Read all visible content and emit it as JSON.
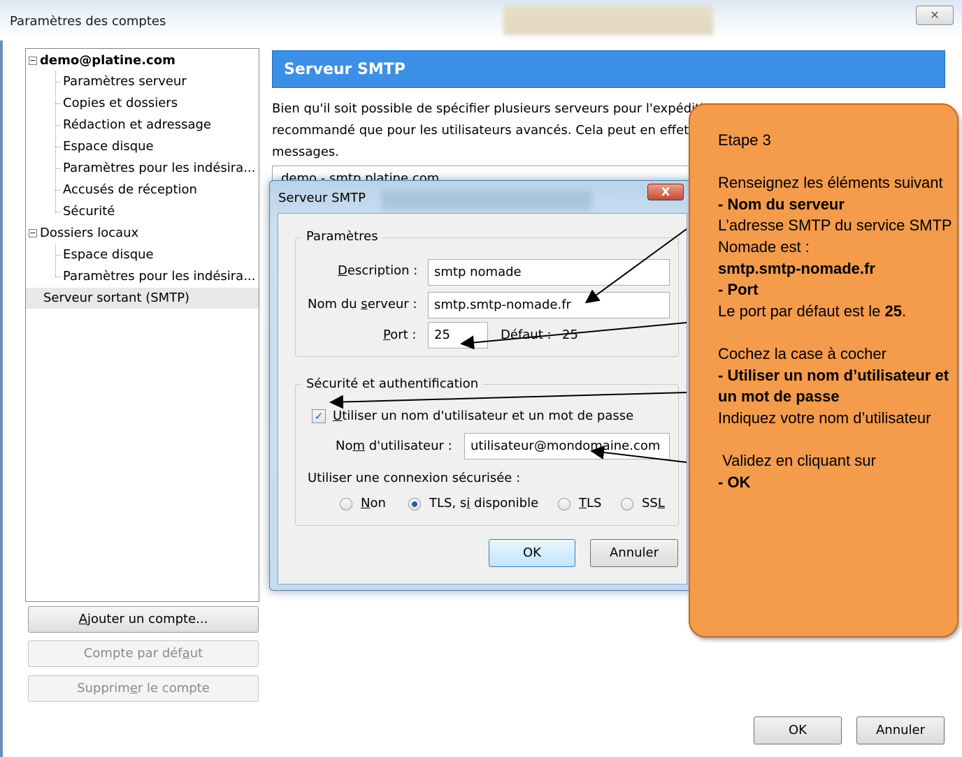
{
  "window": {
    "title": "Paramètres des comptes",
    "close_label": "✕"
  },
  "tree": {
    "account": "demo@platine.com",
    "account_items": [
      "Paramètres serveur",
      "Copies et dossiers",
      "Rédaction et adressage",
      "Espace disque",
      "Paramètres pour les indésira...",
      "Accusés de réception",
      "Sécurité"
    ],
    "local_folders": "Dossiers locaux",
    "local_items": [
      "Espace disque",
      "Paramètres pour les indésira..."
    ],
    "outgoing": "Serveur sortant (SMTP)",
    "expander_glyph": "−"
  },
  "side_buttons": {
    "add_account": {
      "pre": "",
      "mnemonic": "A",
      "post": "jouter un compte..."
    },
    "default_account": {
      "pre": "Compte par déf",
      "mnemonic": "a",
      "post": "ut"
    },
    "delete_account": {
      "pre": "Supprim",
      "mnemonic": "e",
      "post": "r le compte"
    }
  },
  "main": {
    "header": "Serveur SMTP",
    "description_lines": [
      "Bien qu'il soit possible de spécifier plusieurs serveurs pour l'expédition",
      "recommandé que pour les utilisateurs avancés. Cela peut en effet r",
      "messages."
    ],
    "server_list_item": "demo - smtp.platine.com",
    "ok": "OK",
    "cancel": "Annuler"
  },
  "dialog": {
    "title": "Serveur SMTP",
    "close": "X",
    "params_legend": "Paramètres",
    "description_label": {
      "pre": "",
      "mnemonic": "D",
      "post": "escription :"
    },
    "description_value": "smtp nomade",
    "server_label": {
      "pre": "Nom du ",
      "mnemonic": "s",
      "post": "erveur :"
    },
    "server_value": "smtp.smtp-nomade.fr",
    "port_label": {
      "pre": "",
      "mnemonic": "P",
      "post": "ort :"
    },
    "port_value": "25",
    "default_port_label": "Défaut :",
    "default_port_value": "25",
    "security_legend": "Sécurité et authentification",
    "use_auth": {
      "pre": "",
      "mnemonic": "U",
      "post": "tiliser un nom d'utilisateur et un mot de passe",
      "checked": true
    },
    "check_glyph": "✓",
    "username_label": {
      "pre": "No",
      "mnemonic": "m",
      "post": " d'utilisateur :"
    },
    "username_value": "utilisateur@mondomaine.com",
    "secure_conn_label": "Utiliser une connexion sécurisée :",
    "radio_options": [
      {
        "pre": "",
        "mnemonic": "N",
        "post": "on",
        "selected": false
      },
      {
        "pre": "TLS, s",
        "mnemonic": "i",
        "post": " disponible",
        "selected": true
      },
      {
        "pre": "",
        "mnemonic": "T",
        "post": "LS",
        "selected": false
      },
      {
        "pre": "SS",
        "mnemonic": "L",
        "post": "",
        "selected": false
      }
    ],
    "ok": "OK",
    "cancel": "Annuler"
  },
  "callout": {
    "step": "Etape 3",
    "intro": "Renseignez les éléments suivant",
    "server_heading": "- Nom du serveur",
    "server_text": "L’adresse SMTP du service SMTP Nomade est :",
    "server_value": "smtp.smtp-nomade.fr",
    "port_heading": "- Port",
    "port_text": "Le port par défaut est le",
    "port_value": "25",
    "port_suffix": ".",
    "check_intro": "Cochez la case à cocher",
    "check_heading": "- Utiliser un nom d’utilisateur et un mot de passe",
    "user_text": "Indiquez votre nom d’utilisateur",
    "validate_text": " Validez en cliquant sur",
    "ok_heading": "- OK",
    "fill_color": "#f59b4c"
  }
}
